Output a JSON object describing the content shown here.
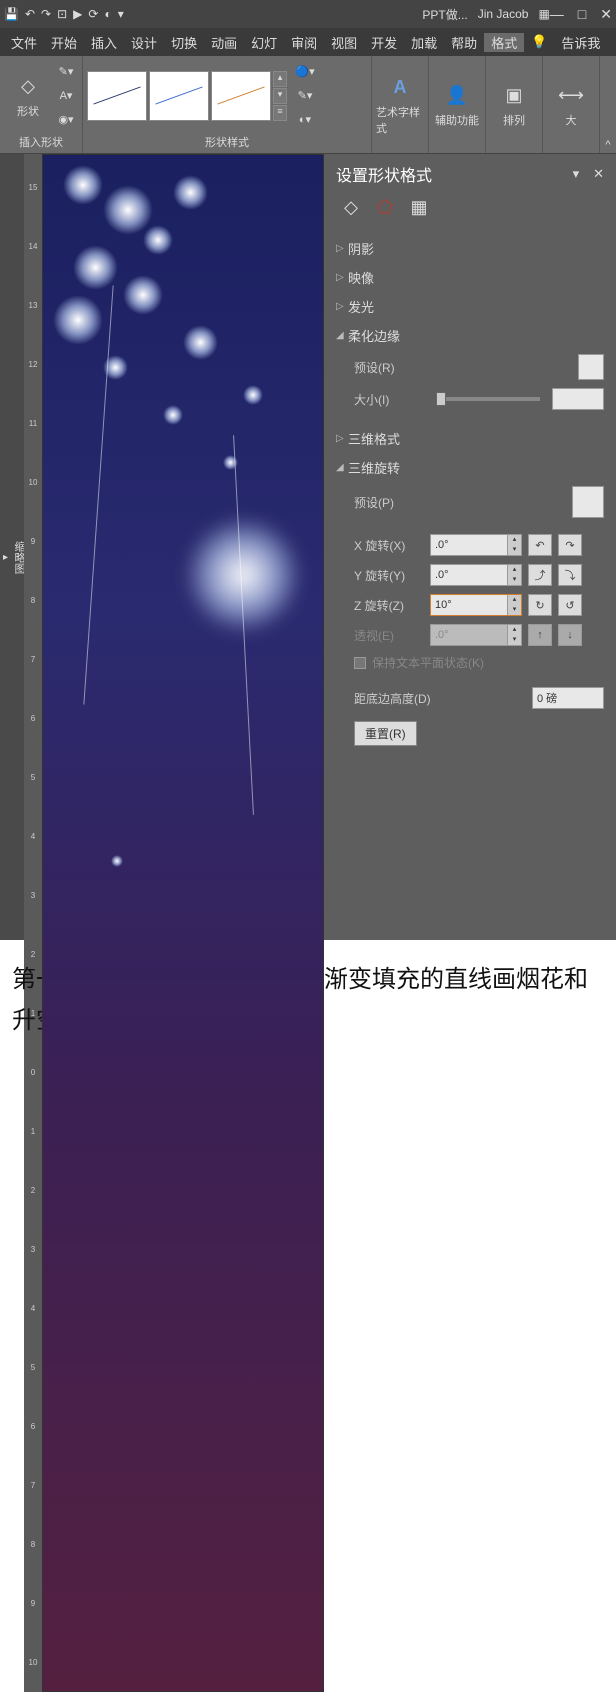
{
  "titlebar": {
    "doc_label": "PPT做...",
    "user": "Jin Jacob"
  },
  "menu": {
    "file": "文件",
    "home": "开始",
    "insert": "插入",
    "design": "设计",
    "transition": "切换",
    "animation": "动画",
    "slideshow": "幻灯",
    "review": "审阅",
    "view": "视图",
    "dev": "开发",
    "addin": "加载",
    "help": "帮助",
    "format": "格式",
    "tellme": "告诉我"
  },
  "ribbon": {
    "insert_shape": "插入形状",
    "shape": "形状",
    "shape_styles": "形状样式",
    "wordart": "艺术字样式",
    "accessibility": "辅助功能",
    "arrange": "排列",
    "size": "大"
  },
  "panel": {
    "title": "设置形状格式",
    "shadow": "阴影",
    "reflection": "映像",
    "glow": "发光",
    "soft_edges": "柔化边缘",
    "preset_r": "预设(R)",
    "size_i": "大小(I)",
    "format_3d": "三维格式",
    "rotation_3d": "三维旋转",
    "preset_p": "预设(P)",
    "x_rot": "X 旋转(X)",
    "y_rot": "Y 旋转(Y)",
    "z_rot": "Z 旋转(Z)",
    "perspective": "透视(E)",
    "x_val": ".0°",
    "y_val": ".0°",
    "z_val": "10°",
    "p_val": ".0°",
    "keep_flat": "保持文本平面状态(K)",
    "distance": "距底边高度(D)",
    "distance_val": "0 磅",
    "reset": "重置(R)"
  },
  "side": {
    "thumbnails": "缩略图"
  },
  "bottom": {
    "text": "第一步，利用圆形、椭圆形和渐变填充的直线画烟花和升空的那部分；"
  }
}
